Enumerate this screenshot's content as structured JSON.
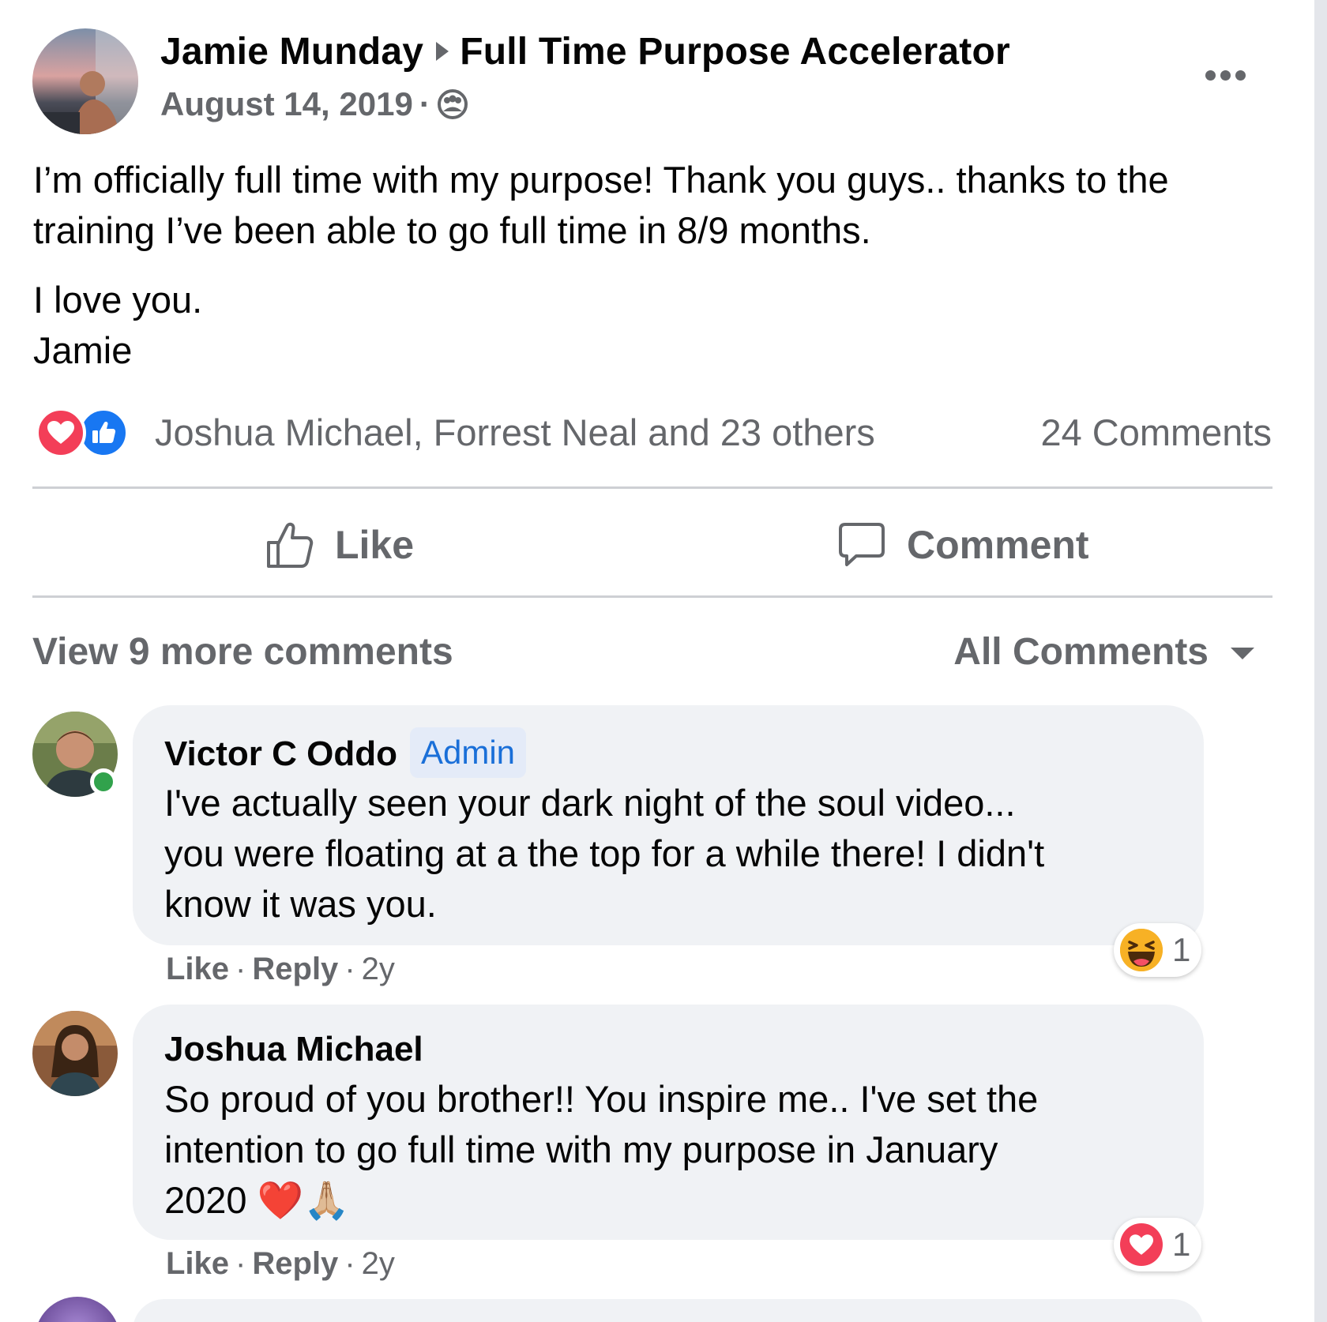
{
  "post": {
    "author": "Jamie Munday",
    "group": "Full Time Purpose Accelerator",
    "date": "August 14, 2019",
    "separator": "·",
    "privacy_icon": "group-members-icon",
    "more_icon": "more-options-icon",
    "paragraphs": [
      "I’m officially full time with my purpose! Thank you guys.. thanks to the training I’ve been able to go full time in 8/9 months.",
      "I love you.",
      "Jamie"
    ]
  },
  "reactions": {
    "icons": [
      "love-reaction-icon",
      "like-reaction-icon"
    ],
    "summary": "Joshua Michael, Forrest Neal and 23 others",
    "comments_count": "24 Comments"
  },
  "actions": {
    "like_label": "Like",
    "comment_label": "Comment"
  },
  "comments_header": {
    "view_more": "View 9 more comments",
    "sort_label": "All Comments"
  },
  "comments": [
    {
      "author": "Victor C Oddo",
      "badge": "Admin",
      "online": true,
      "lines": [
        "I've actually seen your dark night of the soul video...",
        "you were floating at a the top for a while there! I didn't",
        "know it was you."
      ],
      "like_label": "Like",
      "reply_label": "Reply",
      "age": "2y",
      "separator": "·",
      "reaction_icon": "haha-reaction-icon",
      "reaction_count": "1"
    },
    {
      "author": "Joshua Michael",
      "lines": [
        "So proud of you brother!! You inspire me.. I've set the",
        "intention to go full time with my purpose in January",
        "2020 ❤️🙏🏼"
      ],
      "like_label": "Like",
      "reply_label": "Reply",
      "age": "2y",
      "separator": "·",
      "reaction_icon": "love-reaction-icon",
      "reaction_count": "1"
    }
  ],
  "colors": {
    "secondary_text": "#65676b",
    "like_blue": "#1877f2",
    "love_red": "#f33e58",
    "bubble_bg": "#f0f2f5",
    "admin_badge": "#1a6fd8",
    "online_green": "#31a24c"
  }
}
